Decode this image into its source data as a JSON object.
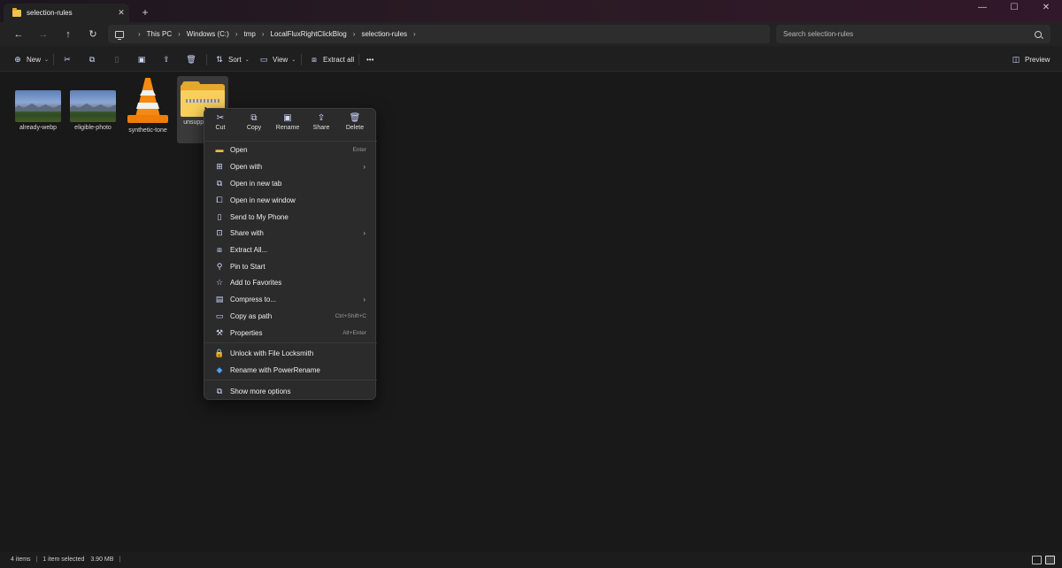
{
  "titlebar": {
    "tab_title": "selection-rules",
    "tab_close": "✕",
    "new_tab": "+",
    "minimize": "—",
    "maximize": "☐",
    "close": "✕"
  },
  "nav": {
    "back": "←",
    "forward": "→",
    "up": "↑",
    "refresh": "↻",
    "breadcrumbs": [
      "This PC",
      "Windows (C:)",
      "tmp",
      "LocalFluxRightClickBlog",
      "selection-rules"
    ],
    "search_placeholder": "Search selection-rules"
  },
  "command_bar": {
    "new_label": "New",
    "sort_label": "Sort",
    "view_label": "View",
    "extract_all_label": "Extract all",
    "more": "•••",
    "preview_label": "Preview"
  },
  "files": [
    {
      "name": "already-webp",
      "type": "image"
    },
    {
      "name": "eligible-photo",
      "type": "image"
    },
    {
      "name": "synthetic-tone",
      "type": "vlc-media"
    },
    {
      "name": "unsupported-zip",
      "type": "zip-folder",
      "label_visible": "unsuppo... zip"
    }
  ],
  "context_menu": {
    "quick_actions": [
      "Cut",
      "Copy",
      "Rename",
      "Share",
      "Delete"
    ],
    "items": [
      {
        "label": "Open",
        "shortcut": "Enter"
      },
      {
        "label": "Open with",
        "submenu": true
      },
      {
        "label": "Open in new tab"
      },
      {
        "label": "Open in new window"
      },
      {
        "label": "Send to My Phone"
      },
      {
        "label": "Share with",
        "submenu": true
      },
      {
        "label": "Extract All..."
      },
      {
        "label": "Pin to Start"
      },
      {
        "label": "Add to Favorites"
      },
      {
        "label": "Compress to...",
        "submenu": true
      },
      {
        "label": "Copy as path",
        "shortcut": "Ctrl+Shift+C"
      },
      {
        "label": "Properties",
        "shortcut": "Alt+Enter"
      }
    ],
    "extensions": [
      {
        "label": "Unlock with File Locksmith"
      },
      {
        "label": "Rename with PowerRename"
      }
    ],
    "more_options": "Show more options"
  },
  "status": {
    "items": "4 items",
    "selected": "1 item selected",
    "size": "3.90 MB"
  },
  "colors": {
    "background": "#191919",
    "menu": "#2b2b2b",
    "folder": "#f8cf5c",
    "accent_icon": "#cfd8ff"
  }
}
